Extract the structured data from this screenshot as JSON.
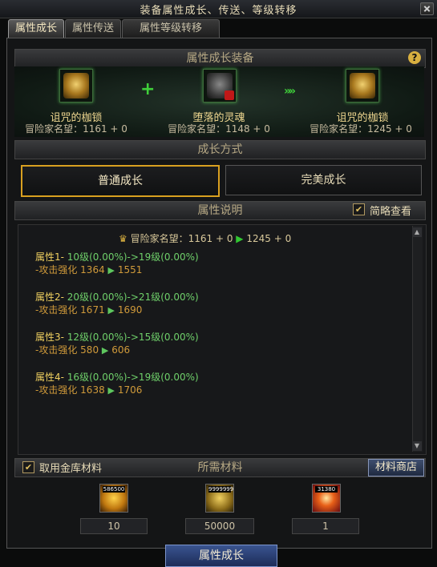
{
  "window": {
    "title": "装备属性成长、传送、等级转移"
  },
  "tabs": [
    {
      "label": "属性成长",
      "active": true
    },
    {
      "label": "属性传送",
      "active": false
    },
    {
      "label": "属性等级转移",
      "active": false
    }
  ],
  "equip_section": {
    "header": "属性成长装备",
    "help": "?",
    "items": [
      {
        "name": "诅咒的枷锁",
        "stat": "冒险家名望：1161 + 0",
        "icon": "gold-shackle-icon"
      },
      {
        "name": "堕落的灵魂",
        "stat": "冒险家名望：1148 + 0",
        "icon": "dark-soul-icon"
      },
      {
        "name": "诅咒的枷锁",
        "stat": "冒险家名望：1245 + 0",
        "icon": "gold-shackle-icon"
      }
    ]
  },
  "growth_mode": {
    "header": "成长方式",
    "options": [
      {
        "label": "普通成长",
        "selected": true
      },
      {
        "label": "完美成长",
        "selected": false
      }
    ]
  },
  "attr_desc": {
    "header": "属性说明",
    "brief_view": {
      "label": "简略查看",
      "checked": true
    },
    "summary": {
      "label": "冒险家名望：",
      "from": "1161 + 0",
      "to": "1245 + 0"
    },
    "attributes": [
      {
        "label": "属性1-",
        "range": "10级(0.00%)->19级(0.00%)",
        "sub": "-攻击强化",
        "from": "1364",
        "to": "1551"
      },
      {
        "label": "属性2-",
        "range": "20级(0.00%)->21级(0.00%)",
        "sub": "-攻击强化",
        "from": "1671",
        "to": "1690"
      },
      {
        "label": "属性3-",
        "range": "12级(0.00%)->15级(0.00%)",
        "sub": "-攻击强化",
        "from": "580",
        "to": "606"
      },
      {
        "label": "属性4-",
        "range": "16级(0.00%)->19级(0.00%)",
        "sub": "-攻击强化",
        "from": "1638",
        "to": "1706"
      }
    ]
  },
  "materials": {
    "use_vault": {
      "label": "取用金库材料",
      "checked": true
    },
    "header": "所需材料",
    "shop_button": "材料商店",
    "items": [
      {
        "count": "586500",
        "required": "10",
        "icon": "gem-icon"
      },
      {
        "count": "9999999",
        "required": "50000",
        "icon": "gold-coins-icon"
      },
      {
        "count": "31380",
        "required": "1",
        "icon": "energy-orb-icon"
      }
    ]
  },
  "action_button": "属性成长",
  "colors": {
    "accent_gold": "#d9a020",
    "green": "#32c832",
    "button_blue": "#2a4280"
  }
}
